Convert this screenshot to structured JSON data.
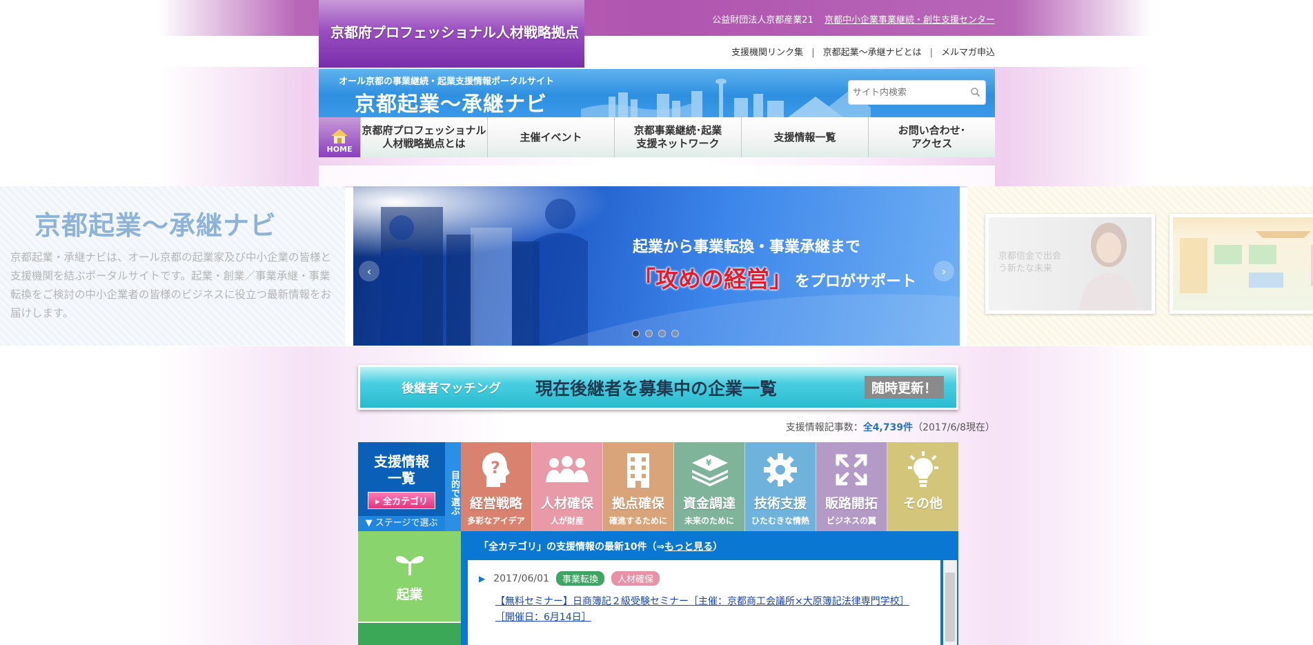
{
  "header": {
    "logo": "京都府プロフェッショナル人材戦略拠点",
    "org_name": "公益財団法人京都産業21",
    "org_link": "京都中小企業事業継続・創生支援センター",
    "util_links": [
      "支援機関リンク集",
      "京都起業～承継ナビとは",
      "メルマガ申込"
    ],
    "util_sep": "|"
  },
  "brand": {
    "subtitle": "オール京都の事業継続・起業支援情報ポータルサイト",
    "title": "京都起業～承継ナビ",
    "search_placeholder": "サイト内検索"
  },
  "nav": {
    "home_label": "HOME",
    "items": [
      "京都府プロフェッショナル\n人材戦略拠点とは",
      "主催イベント",
      "京都事業継続･起業\n支援ネットワーク",
      "支援情報一覧",
      "お問い合わせ･\nアクセス"
    ]
  },
  "hero": {
    "left_title": "京都起業～承継ナビ",
    "left_text": "京都起業・承継ナビは、オール京都の起業家及び中小企業の皆様と支援機関を結ぶポータルサイトです。起業・創業／事業承継・事業転換をご検討の中小企業者の皆様のビジネスに役立つ最新情報をお届けします。",
    "caption1": "起業から事業転換・事業承継まで",
    "caption2": "「攻めの経営」",
    "caption3": "をプロがサポート",
    "slides": 4,
    "active_slide": 1,
    "right_thumb_text": "京都信金で出会う新たな未来"
  },
  "banner": {
    "left": "後継者マッチング",
    "main": "現在後継者を募集中の企業一覧",
    "badge": "随時更新！"
  },
  "count": {
    "prefix": "支援情報記事数：",
    "value": "全4,739件",
    "suffix": "（2017/6/8現在）"
  },
  "category": {
    "side_title": "支援情報\n一覧",
    "all_button": "▸ 全カテゴリ",
    "stage_label": "▼ ステージで選ぶ",
    "purpose_label": "目的で選ぶ",
    "items": [
      {
        "name": "経営戦略",
        "sub": "多彩なアイデア",
        "color": "#d9826f"
      },
      {
        "name": "人材確保",
        "sub": "人が財産",
        "color": "#e89aa8"
      },
      {
        "name": "拠点確保",
        "sub": "確進するために",
        "color": "#d9a47a"
      },
      {
        "name": "資金調達",
        "sub": "未来のために",
        "color": "#7fb39a"
      },
      {
        "name": "技術支援",
        "sub": "ひたむきな情熱",
        "color": "#6fb2dc"
      },
      {
        "name": "販路開拓",
        "sub": "ビジネスの翼",
        "color": "#b49ac6"
      },
      {
        "name": "その他",
        "sub": "",
        "color": "#d3c579"
      }
    ],
    "stage1": "起業"
  },
  "news": {
    "heading_prefix": "「全カテゴリ」の支援情報の最新10件（⇒",
    "heading_link": "もっと見る",
    "heading_suffix": "）",
    "date": "2017/06/01",
    "tag1": "事業転換",
    "tag2": "人材確保",
    "link_line1": "【無料セミナー】日商簿記２級受験セミナー［主催：京都商工会議所×大原簿記法律専門学校］",
    "link_line2": "［開催日：6月14日］"
  }
}
